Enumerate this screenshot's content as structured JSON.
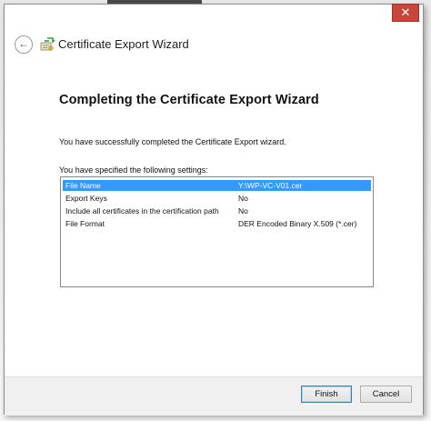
{
  "window": {
    "close_label": "✕"
  },
  "header": {
    "back_glyph": "←",
    "wizard_title": "Certificate Export Wizard",
    "icon": "certificate-wizard-icon"
  },
  "main": {
    "page_title": "Completing the Certificate Export Wizard",
    "success_text": "You have successfully completed the Certificate Export wizard.",
    "settings_label": "You have specified the following settings:",
    "settings": [
      {
        "name": "File Name",
        "value": "Y:\\WP-VC-V01.cer",
        "selected": true
      },
      {
        "name": "Export Keys",
        "value": "No",
        "selected": false
      },
      {
        "name": "Include all certificates in the certification path",
        "value": "No",
        "selected": false
      },
      {
        "name": "File Format",
        "value": "DER Encoded Binary X.509 (*.cer)",
        "selected": false
      }
    ]
  },
  "footer": {
    "finish_label": "Finish",
    "cancel_label": "Cancel"
  },
  "colors": {
    "selection": "#3399ff",
    "close_button": "#c7463c",
    "default_button_border": "#3c7fb1"
  }
}
